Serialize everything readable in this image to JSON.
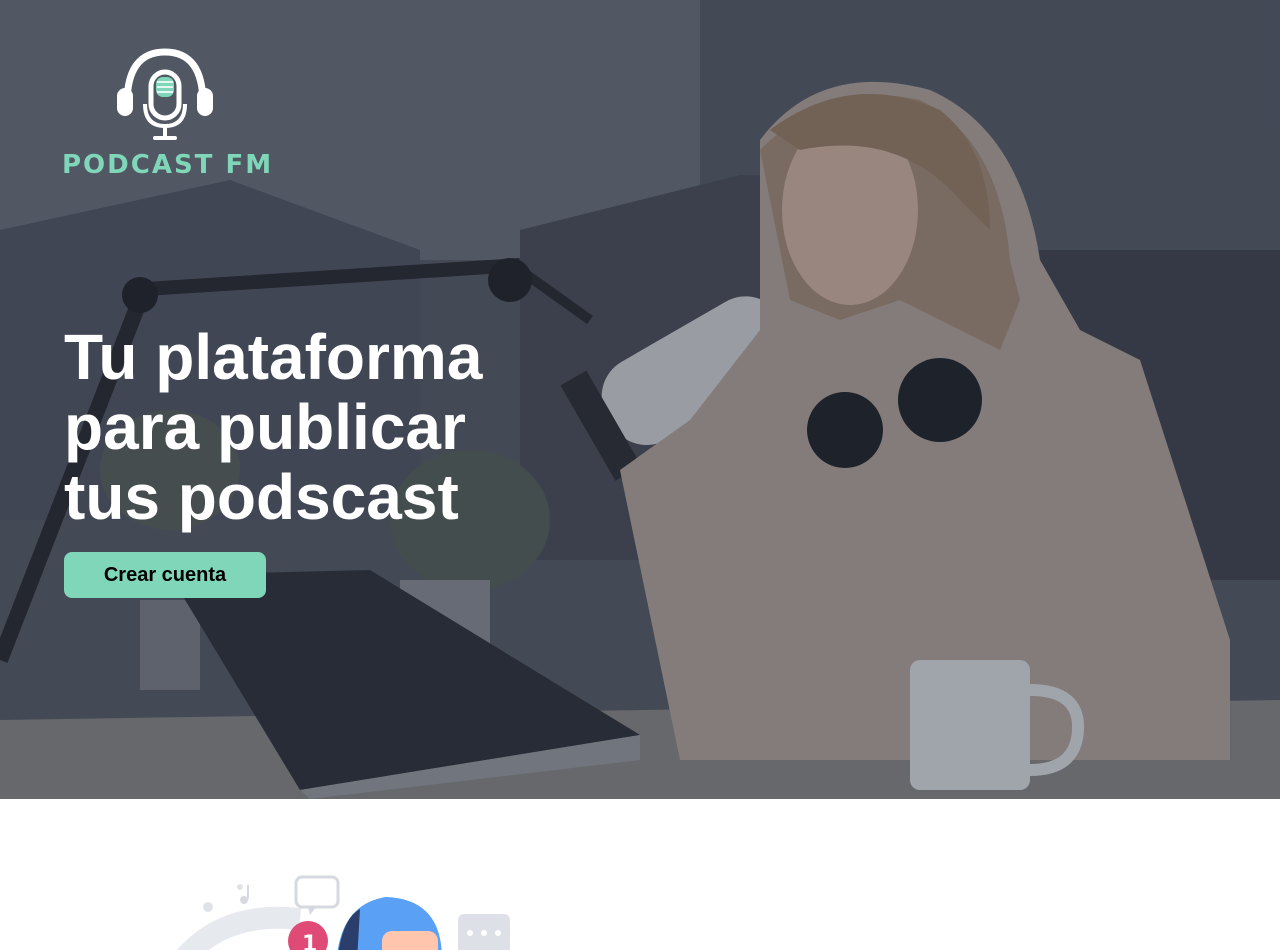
{
  "brand": {
    "name": "PODCAST FM",
    "accent_color": "#7fd6b8",
    "logo_icon": "headphones-microphone-icon"
  },
  "hero": {
    "headline_lines": [
      "Tu plataforma",
      "para publicar",
      "tus podscast"
    ],
    "cta_label": "Crear cuenta",
    "background": "woman-podcasting-photo"
  },
  "illustration": {
    "icons": [
      "music-note-icon",
      "chat-bubble-icon",
      "avatar-icon",
      "typing-bubble-icon",
      "pink-badge-icon"
    ]
  }
}
